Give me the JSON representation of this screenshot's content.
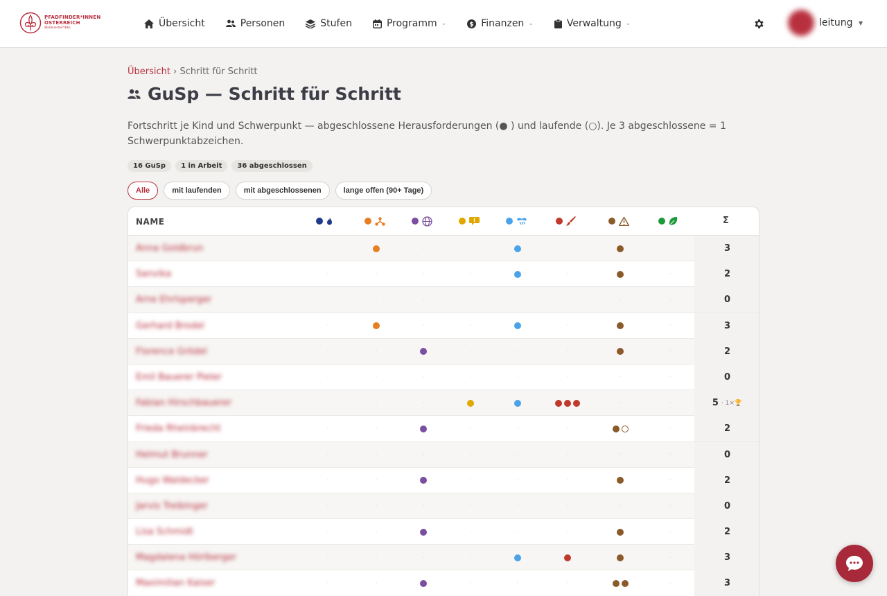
{
  "brand": {
    "line1": "PFADFINDER*INNEN",
    "line2": "ÖSTERREICH",
    "line3": "Waldviertel/Ybbs"
  },
  "nav": [
    {
      "label": "Übersicht",
      "icon": "home-icon",
      "dropdown": false
    },
    {
      "label": "Personen",
      "icon": "users-icon",
      "dropdown": false
    },
    {
      "label": "Stufen",
      "icon": "layers-icon",
      "dropdown": false
    },
    {
      "label": "Programm",
      "icon": "calendar-icon",
      "dropdown": true
    },
    {
      "label": "Finanzen",
      "icon": "dollar-icon",
      "dropdown": true
    },
    {
      "label": "Verwaltung",
      "icon": "clipboard-icon",
      "dropdown": true
    }
  ],
  "user": {
    "name": "leitung"
  },
  "breadcrumb": {
    "parent": "Übersicht",
    "separator": "›",
    "current": "Schritt für Schritt"
  },
  "page": {
    "title": "GuSp — Schritt für Schritt",
    "description": "Fortschritt je Kind und Schwerpunkt — abgeschlossene Herausforderungen (● ) und laufende (○). Je 3 abgeschlossene = 1 Schwerpunktabzeichen."
  },
  "stats": [
    "16 GuSp",
    "1 in Arbeit",
    "36 abgeschlossen"
  ],
  "filters": [
    {
      "label": "Alle",
      "active": true
    },
    {
      "label": "mit laufenden",
      "active": false
    },
    {
      "label": "mit abgeschlossenen",
      "active": false
    },
    {
      "label": "lange offen (90+ Tage)",
      "active": false
    }
  ],
  "table": {
    "name_header": "NAME",
    "sum_header": "Σ",
    "columns": [
      {
        "color": "#1f3a8a",
        "icon": "flame-icon",
        "icon_color": "#1f3a8a"
      },
      {
        "color": "#e67e22",
        "icon": "network-icon",
        "icon_color": "#e67e22"
      },
      {
        "color": "#7b4fa0",
        "icon": "globe-icon",
        "icon_color": "#7b4fa0"
      },
      {
        "color": "#e0a800",
        "icon": "speech-icon",
        "icon_color": "#e0a800"
      },
      {
        "color": "#4aa3e8",
        "icon": "handshake-icon",
        "icon_color": "#4aa3e8"
      },
      {
        "color": "#c0392b",
        "icon": "brush-icon",
        "icon_color": "#c0392b"
      },
      {
        "color": "#8a5a2b",
        "icon": "warning-icon",
        "icon_color": "#8a5a2b"
      },
      {
        "color": "#1e9a3a",
        "icon": "leaf-icon",
        "icon_color": "#1e9a3a"
      }
    ],
    "rows": [
      {
        "name": "Anna Goldbrun",
        "cells": [
          0,
          1,
          0,
          0,
          1,
          0,
          1,
          0
        ],
        "open": [
          0,
          0,
          0,
          0,
          0,
          0,
          0,
          0
        ],
        "sum": "3",
        "badge": ""
      },
      {
        "name": "Sanvika",
        "cells": [
          0,
          0,
          0,
          0,
          1,
          0,
          1,
          0
        ],
        "open": [
          0,
          0,
          0,
          0,
          0,
          0,
          0,
          0
        ],
        "sum": "2",
        "badge": ""
      },
      {
        "name": "Arne Ehrlsperger",
        "cells": [
          0,
          0,
          0,
          0,
          0,
          0,
          0,
          0
        ],
        "open": [
          0,
          0,
          0,
          0,
          0,
          0,
          0,
          0
        ],
        "sum": "0",
        "badge": ""
      },
      {
        "name": "Gerhard Brodel",
        "cells": [
          0,
          1,
          0,
          0,
          1,
          0,
          1,
          0
        ],
        "open": [
          0,
          0,
          0,
          0,
          0,
          0,
          0,
          0
        ],
        "sum": "3",
        "badge": ""
      },
      {
        "name": "Florence Grödel",
        "cells": [
          0,
          0,
          1,
          0,
          0,
          0,
          1,
          0
        ],
        "open": [
          0,
          0,
          0,
          0,
          0,
          0,
          0,
          0
        ],
        "sum": "2",
        "badge": ""
      },
      {
        "name": "Emil Bauerer Pieler",
        "cells": [
          0,
          0,
          0,
          0,
          0,
          0,
          0,
          0
        ],
        "open": [
          0,
          0,
          0,
          0,
          0,
          0,
          0,
          0
        ],
        "sum": "0",
        "badge": ""
      },
      {
        "name": "Fabian Hirschbauerer",
        "cells": [
          0,
          0,
          0,
          1,
          1,
          3,
          0,
          0
        ],
        "open": [
          0,
          0,
          0,
          0,
          0,
          0,
          0,
          0
        ],
        "sum": "5",
        "badge": "· 1×🏆"
      },
      {
        "name": "Frieda Rheinbrecht",
        "cells": [
          0,
          0,
          1,
          0,
          0,
          0,
          1,
          0
        ],
        "open": [
          0,
          0,
          0,
          0,
          0,
          0,
          1,
          0
        ],
        "sum": "2",
        "badge": ""
      },
      {
        "name": "Helmut Brunner",
        "cells": [
          0,
          0,
          0,
          0,
          0,
          0,
          0,
          0
        ],
        "open": [
          0,
          0,
          0,
          0,
          0,
          0,
          0,
          0
        ],
        "sum": "0",
        "badge": ""
      },
      {
        "name": "Hugo Waldecker",
        "cells": [
          0,
          0,
          1,
          0,
          0,
          0,
          1,
          0
        ],
        "open": [
          0,
          0,
          0,
          0,
          0,
          0,
          0,
          0
        ],
        "sum": "2",
        "badge": ""
      },
      {
        "name": "Jarvis Treibinger",
        "cells": [
          0,
          0,
          0,
          0,
          0,
          0,
          0,
          0
        ],
        "open": [
          0,
          0,
          0,
          0,
          0,
          0,
          0,
          0
        ],
        "sum": "0",
        "badge": ""
      },
      {
        "name": "Lisa Schmidt",
        "cells": [
          0,
          0,
          1,
          0,
          0,
          0,
          1,
          0
        ],
        "open": [
          0,
          0,
          0,
          0,
          0,
          0,
          0,
          0
        ],
        "sum": "2",
        "badge": ""
      },
      {
        "name": "Magdalena Hörlberger",
        "cells": [
          0,
          0,
          0,
          0,
          1,
          1,
          1,
          0
        ],
        "open": [
          0,
          0,
          0,
          0,
          0,
          0,
          0,
          0
        ],
        "sum": "3",
        "badge": ""
      },
      {
        "name": "Maximilian Kaiser",
        "cells": [
          0,
          0,
          1,
          0,
          0,
          0,
          2,
          0
        ],
        "open": [
          0,
          0,
          0,
          0,
          0,
          0,
          0,
          0
        ],
        "sum": "3",
        "badge": ""
      }
    ]
  }
}
